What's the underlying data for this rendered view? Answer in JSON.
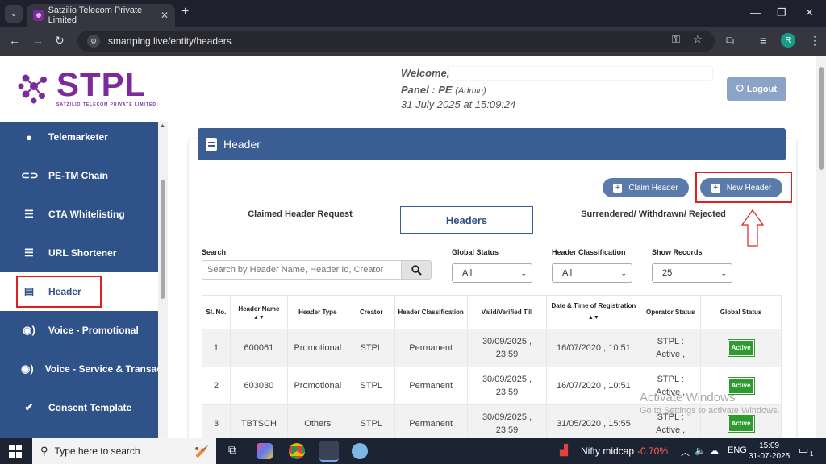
{
  "browser": {
    "tab_title": "Satzilio Telecom Private Limited",
    "url": "smartping.live/entity/headers",
    "profile_initial": "R"
  },
  "logo": {
    "text": "STPL",
    "subtitle": "SATZILIO TELECOM PRIVATE LIMITED"
  },
  "sidebar": {
    "items": [
      {
        "label": "Telemarketer",
        "icon": "user-circle-icon"
      },
      {
        "label": "PE-TM Chain",
        "icon": "link-icon"
      },
      {
        "label": "CTA Whitelisting",
        "icon": "list-icon"
      },
      {
        "label": "URL Shortener",
        "icon": "list-icon"
      },
      {
        "label": "Header",
        "icon": "clipboard-icon"
      },
      {
        "label": "Voice - Promotional",
        "icon": "voice-icon"
      },
      {
        "label": "Voice - Service & Transac",
        "icon": "voice-icon"
      },
      {
        "label": "Consent Template",
        "icon": "check-circle-icon"
      }
    ]
  },
  "topbar": {
    "welcome": "Welcome,",
    "panel": "Panel : PE",
    "role": "(Admin)",
    "date": "31 July 2025 at 15:09:24",
    "logout": "Logout"
  },
  "card": {
    "title": "Header",
    "claim_button": "Claim Header",
    "new_button": "New Header",
    "tabs": [
      "Claimed Header Request",
      "Headers",
      "Surrendered/ Withdrawn/ Rejected"
    ],
    "active_tab": "Headers"
  },
  "filters": {
    "search_label": "Search",
    "search_placeholder": "Search by Header Name, Header Id, Creator",
    "global_status_label": "Global Status",
    "global_status_value": "All",
    "classification_label": "Header Classification",
    "classification_value": "All",
    "records_label": "Show Records",
    "records_value": "25"
  },
  "table": {
    "headers": [
      "Sl. No.",
      "Header Name",
      "Header Type",
      "Creator",
      "Header Classification",
      "Valid/Verified Till",
      "Date & Time of Registration",
      "Operator Status",
      "Global Status"
    ],
    "rows": [
      {
        "no": "1",
        "name": "600061",
        "type": "Promotional",
        "creator": "STPL",
        "classification": "Permanent",
        "valid": "30/09/2025 ,",
        "valid_time": "23:59",
        "registered": "16/07/2020 , 10:51",
        "op_status": "STPL :",
        "op_status2": "Active ,",
        "global": "Active"
      },
      {
        "no": "2",
        "name": "603030",
        "type": "Promotional",
        "creator": "STPL",
        "classification": "Permanent",
        "valid": "30/09/2025 ,",
        "valid_time": "23:59",
        "registered": "16/07/2020 , 10:51",
        "op_status": "STPL :",
        "op_status2": "Active ,",
        "global": "Active"
      },
      {
        "no": "3",
        "name": "TBTSCH",
        "type": "Others",
        "creator": "STPL",
        "classification": "Permanent",
        "valid": "30/09/2025 ,",
        "valid_time": "23:59",
        "registered": "31/05/2020 , 15:55",
        "op_status": "STPL :",
        "op_status2": "Active ,",
        "global": "Active"
      }
    ]
  },
  "watermark": {
    "line1": "Activate Windows",
    "line2": "Go to Settings to activate Windows."
  },
  "taskbar": {
    "search_placeholder": "Type here to search",
    "ticker_name": "Nifty midcap",
    "ticker_value": "-0.70%",
    "language": "ENG",
    "time": "15:09",
    "date": "31-07-2025",
    "notification_count": "1"
  }
}
